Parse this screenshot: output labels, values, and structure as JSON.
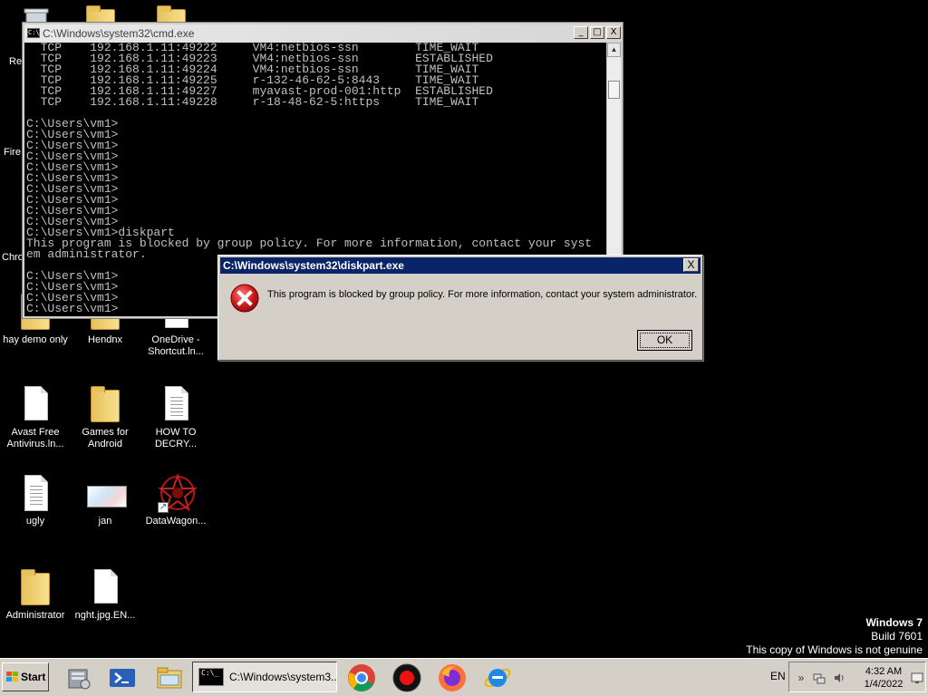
{
  "desktop": {
    "icons": [
      {
        "label": "Re"
      },
      {
        "label": "Fire"
      },
      {
        "label": "Chro"
      },
      {
        "label": "hay demo only"
      },
      {
        "label": "Hendnx"
      },
      {
        "label": "OneDrive - Shortcut.ln..."
      },
      {
        "label": "Avast Free Antivirus.ln..."
      },
      {
        "label": "Games for Android"
      },
      {
        "label": "HOW TO DECRY..."
      },
      {
        "label": "ugly"
      },
      {
        "label": "jan"
      },
      {
        "label": "DataWagon..."
      },
      {
        "label": "Administrator"
      },
      {
        "label": "nght.jpg.EN..."
      }
    ]
  },
  "cmd_window": {
    "title": "C:\\Windows\\system32\\cmd.exe",
    "icon_text": "C:\\",
    "console_text": "  TCP    192.168.1.11:49222     VM4:netbios-ssn        TIME_WAIT\n  TCP    192.168.1.11:49223     VM4:netbios-ssn        ESTABLISHED\n  TCP    192.168.1.11:49224     VM4:netbios-ssn        TIME_WAIT\n  TCP    192.168.1.11:49225     r-132-46-62-5:8443     TIME_WAIT\n  TCP    192.168.1.11:49227     myavast-prod-001:http  ESTABLISHED\n  TCP    192.168.1.11:49228     r-18-48-62-5:https     TIME_WAIT\n\nC:\\Users\\vm1>\nC:\\Users\\vm1>\nC:\\Users\\vm1>\nC:\\Users\\vm1>\nC:\\Users\\vm1>\nC:\\Users\\vm1>\nC:\\Users\\vm1>\nC:\\Users\\vm1>\nC:\\Users\\vm1>\nC:\\Users\\vm1>\nC:\\Users\\vm1>diskpart\nThis program is blocked by group policy. For more information, contact your syst\nem administrator.\n\nC:\\Users\\vm1>\nC:\\Users\\vm1>\nC:\\Users\\vm1>\nC:\\Users\\vm1>",
    "buttons": {
      "minimize": "_",
      "maximize": "□",
      "close": "X"
    },
    "scroll_up": "▲",
    "scroll_down": "▼"
  },
  "dialog": {
    "title": "C:\\Windows\\system32\\diskpart.exe",
    "close": "X",
    "message": "This program is blocked by group policy. For more information, contact your system administrator.",
    "ok_label": "OK"
  },
  "watermark": {
    "line1": "Windows 7",
    "line2": "Build 7601",
    "line3": "This copy of Windows is not genuine"
  },
  "taskbar": {
    "start_label": "Start",
    "task_cmd_label": "C:\\Windows\\system3...",
    "task_cmd_icon_text": "C:\\_",
    "language": "EN",
    "time": "4:32 AM",
    "date": "1/4/2022",
    "tray_expand": "»"
  },
  "colors": {
    "dialog_title_bg": "#0a246a",
    "error_red": "#d11a1a",
    "console_text": "#c0c0c0",
    "desktop_bg": "#000000",
    "taskbar_bg": "#d4d0c8"
  }
}
